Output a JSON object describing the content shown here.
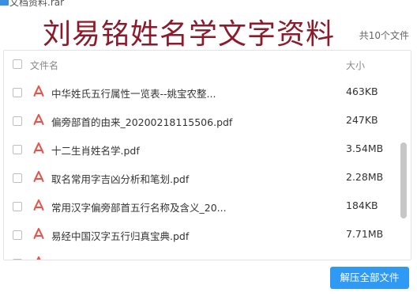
{
  "window": {
    "title": "文档资料.rar"
  },
  "overlay_title": "刘易铭姓名学文字资料",
  "total_label": "共10个文件",
  "table": {
    "columns": {
      "name": "文件名",
      "size": "大小"
    },
    "rows": [
      {
        "name": "中华姓氏五行属性一览表--姚宝农整...",
        "size": "463KB"
      },
      {
        "name": "偏旁部首的由来_20200218115506.pdf",
        "size": "247KB"
      },
      {
        "name": "十二生肖姓名学.pdf",
        "size": "3.54MB"
      },
      {
        "name": "取名常用字吉凶分析和笔划.pdf",
        "size": "2.28MB"
      },
      {
        "name": "常用汉字偏旁部首五行名称及含义_20...",
        "size": "184KB"
      },
      {
        "name": "易经中国汉字五行归真宝典.pdf",
        "size": "7.71MB"
      },
      {
        "name": "",
        "size": ""
      }
    ]
  },
  "extract_button": "解压全部文件",
  "colors": {
    "accent": "#2e9af3",
    "title_overlay": "#8b1a2a",
    "pdf_icon": "#e5534b"
  }
}
